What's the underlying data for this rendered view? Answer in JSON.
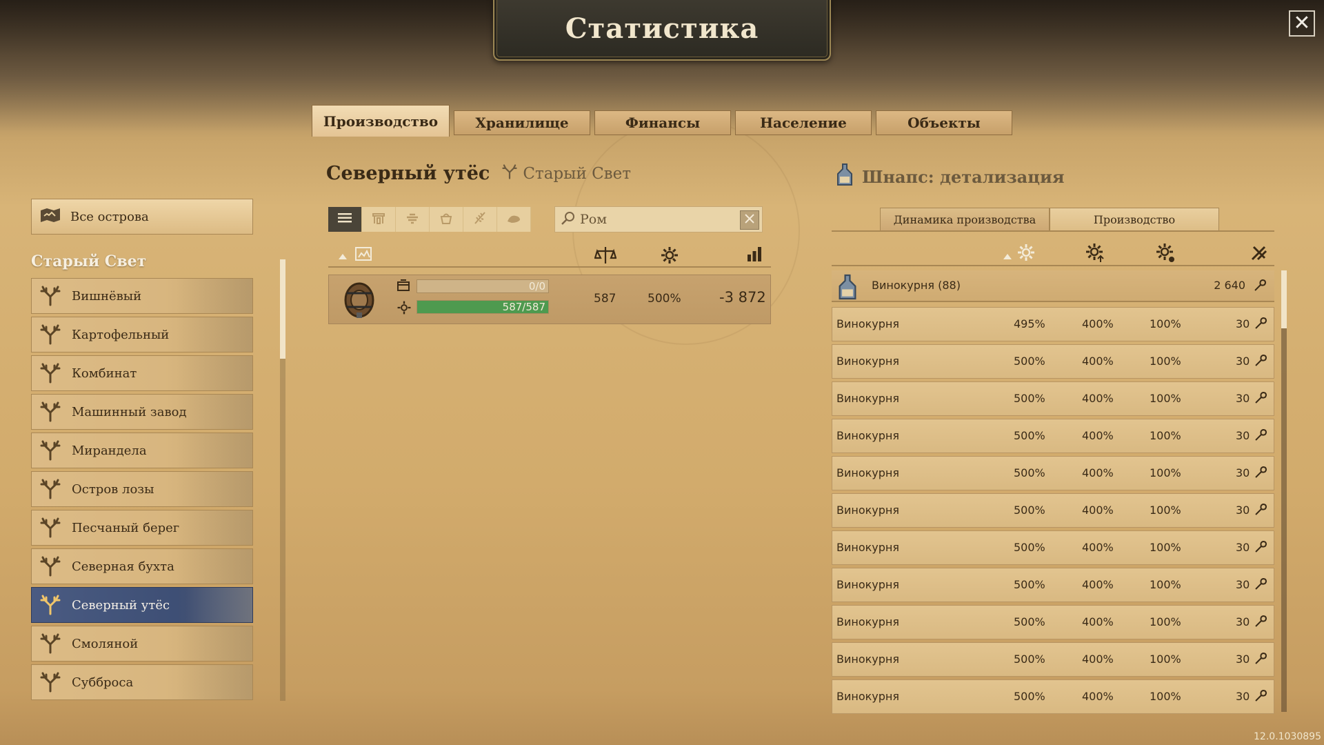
{
  "window": {
    "title": "Статистика",
    "close_label": "✕",
    "version": "12.0.1030895"
  },
  "tabs": [
    {
      "label": "Производство",
      "active": true
    },
    {
      "label": "Хранилище",
      "active": false
    },
    {
      "label": "Финансы",
      "active": false
    },
    {
      "label": "Население",
      "active": false
    },
    {
      "label": "Объекты",
      "active": false
    }
  ],
  "sidebar": {
    "all_islands": "Все острова",
    "section": "Старый Свет",
    "islands": [
      {
        "label": "Вишнёвый"
      },
      {
        "label": "Картофельный"
      },
      {
        "label": "Комбинат"
      },
      {
        "label": "Машинный завод"
      },
      {
        "label": "Мирандела"
      },
      {
        "label": "Остров лозы"
      },
      {
        "label": "Песчаный берег"
      },
      {
        "label": "Северная бухта"
      },
      {
        "label": "Северный утёс",
        "selected": true
      },
      {
        "label": "Смоляной"
      },
      {
        "label": "Субброса"
      }
    ]
  },
  "main": {
    "island_name": "Северный утёс",
    "region": "Старый Свет",
    "search": {
      "value": "Ром",
      "placeholder": ""
    },
    "product": {
      "stock_text": "0/0",
      "stock_fraction": 0,
      "prod_text": "587/587",
      "prod_fraction": 1,
      "balance": "587",
      "productivity": "500%",
      "amount": "-3 872"
    }
  },
  "detail": {
    "title": "Шнапс: детализация",
    "subtabs": [
      {
        "label": "Динамика производства",
        "active": false
      },
      {
        "label": "Производство",
        "active": true
      }
    ],
    "group": {
      "label": "Винокурня (88)",
      "value": "2 640"
    },
    "rows": [
      {
        "name": "Винокурня",
        "prod": "495%",
        "base": "400%",
        "boost": "100%",
        "workers": "30"
      },
      {
        "name": "Винокурня",
        "prod": "500%",
        "base": "400%",
        "boost": "100%",
        "workers": "30"
      },
      {
        "name": "Винокурня",
        "prod": "500%",
        "base": "400%",
        "boost": "100%",
        "workers": "30"
      },
      {
        "name": "Винокурня",
        "prod": "500%",
        "base": "400%",
        "boost": "100%",
        "workers": "30"
      },
      {
        "name": "Винокурня",
        "prod": "500%",
        "base": "400%",
        "boost": "100%",
        "workers": "30"
      },
      {
        "name": "Винокурня",
        "prod": "500%",
        "base": "400%",
        "boost": "100%",
        "workers": "30"
      },
      {
        "name": "Винокурня",
        "prod": "500%",
        "base": "400%",
        "boost": "100%",
        "workers": "30"
      },
      {
        "name": "Винокурня",
        "prod": "500%",
        "base": "400%",
        "boost": "100%",
        "workers": "30"
      },
      {
        "name": "Винокурня",
        "prod": "500%",
        "base": "400%",
        "boost": "100%",
        "workers": "30"
      },
      {
        "name": "Винокурня",
        "prod": "500%",
        "base": "400%",
        "boost": "100%",
        "workers": "30"
      },
      {
        "name": "Винокурня",
        "prod": "500%",
        "base": "400%",
        "boost": "100%",
        "workers": "30"
      }
    ]
  },
  "colors": {
    "accent_green": "#4e9a4f",
    "selected_blue": "#3d4e74",
    "title_plate": "#2c2a22"
  },
  "icons": [
    "antler-icon",
    "map-icon",
    "list-icon",
    "market-icon",
    "factory-icon",
    "basket-icon",
    "wheat-icon",
    "bird-icon",
    "search-icon",
    "close-icon",
    "barrel-icon",
    "gear-icon",
    "chart-icon",
    "balance-icon",
    "wrench-icon",
    "bottle-icon"
  ]
}
